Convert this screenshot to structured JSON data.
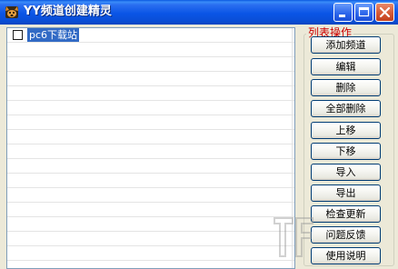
{
  "window": {
    "title": "YY频道创建精灵",
    "icons": {
      "app": "dog-app-icon",
      "minimize": "minimize-icon",
      "maximize": "maximize-icon",
      "close": "close-icon"
    }
  },
  "list": {
    "rows": [
      {
        "label": "pc6下载站",
        "checked": false
      }
    ],
    "empty_row_count": 15
  },
  "group": {
    "label": "列表操作",
    "buttons": [
      "添加频道",
      "编辑",
      "删除",
      "全部删除",
      "上移",
      "下移",
      "导入",
      "导出",
      "检查更新",
      "问题反馈",
      "使用说明"
    ]
  },
  "colors": {
    "titlebar": "#0a55e6",
    "group_label": "#cc0000",
    "selection": "#316ac5"
  }
}
